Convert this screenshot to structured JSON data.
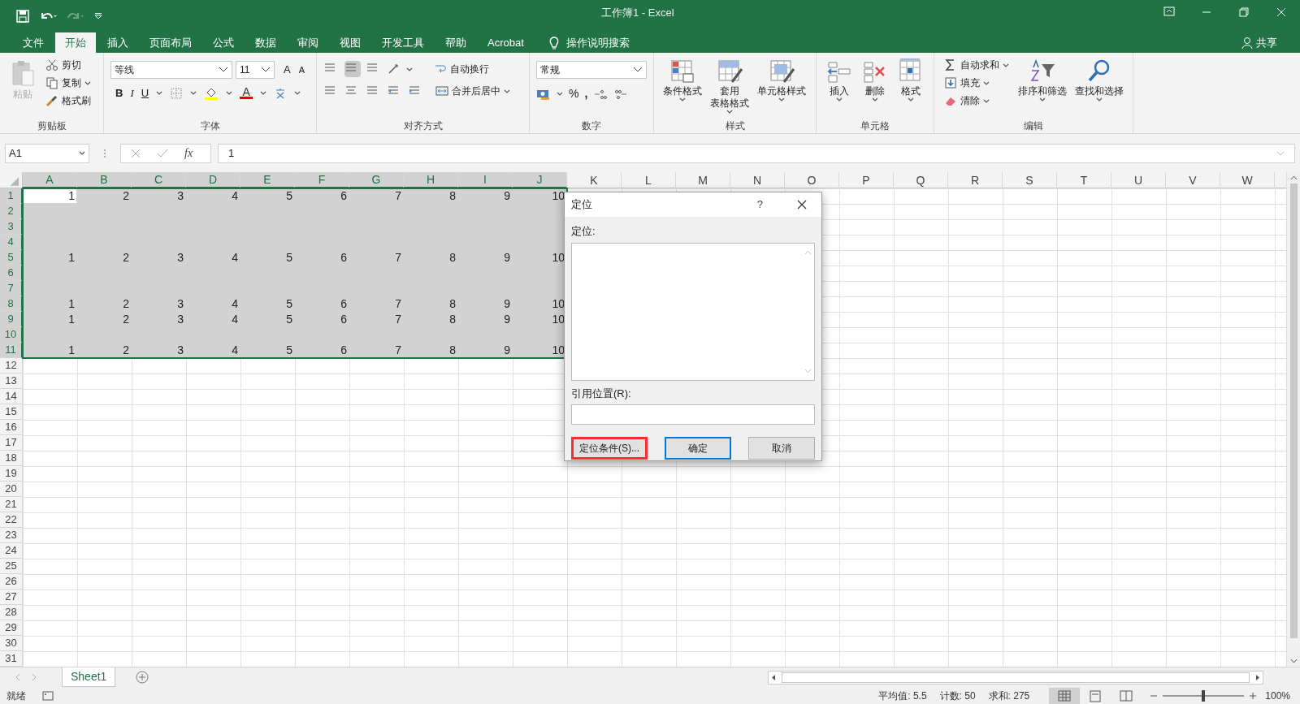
{
  "window": {
    "title": "工作簿1 - Excel"
  },
  "menu_tabs": [
    {
      "label": "文件",
      "selected": false
    },
    {
      "label": "开始",
      "selected": true
    },
    {
      "label": "插入",
      "selected": false
    },
    {
      "label": "页面布局",
      "selected": false
    },
    {
      "label": "公式",
      "selected": false
    },
    {
      "label": "数据",
      "selected": false
    },
    {
      "label": "审阅",
      "selected": false
    },
    {
      "label": "视图",
      "selected": false
    },
    {
      "label": "开发工具",
      "selected": false
    },
    {
      "label": "帮助",
      "selected": false
    },
    {
      "label": "Acrobat",
      "selected": false
    }
  ],
  "tell_me": "操作说明搜索",
  "share": "共享",
  "ribbon": {
    "clipboard": {
      "label": "剪贴板",
      "paste": "粘贴",
      "items": [
        "剪切",
        "复制",
        "格式刷"
      ]
    },
    "font": {
      "label": "字体",
      "font_name": "等线",
      "font_size": "11",
      "grow": "A",
      "shrink": "A",
      "bold": "B",
      "italic": "I",
      "underline": "U",
      "font_color": "A"
    },
    "alignment": {
      "label": "对齐方式",
      "wrap": "自动换行",
      "merge": "合并后居中"
    },
    "number": {
      "label": "数字",
      "format": "常规",
      "percent": "%",
      "comma": ","
    },
    "styles": {
      "label": "样式",
      "buttons": [
        [
          "条件格式"
        ],
        [
          "套用",
          "表格格式"
        ],
        [
          "单元格样式"
        ]
      ]
    },
    "cells": {
      "label": "单元格",
      "buttons": [
        "插入",
        "删除",
        "格式"
      ]
    },
    "editing": {
      "label": "编辑",
      "items": [
        "自动求和",
        "填充",
        "清除"
      ],
      "buttons": [
        "排序和筛选",
        "查找和选择"
      ]
    }
  },
  "formula_bar": {
    "name_box": "A1",
    "fx": "fx",
    "value": "1"
  },
  "sheet": {
    "columns": [
      {
        "label": "A",
        "selected": true
      },
      {
        "label": "B",
        "selected": true
      },
      {
        "label": "C",
        "selected": true
      },
      {
        "label": "D",
        "selected": true
      },
      {
        "label": "E",
        "selected": true
      },
      {
        "label": "F",
        "selected": true
      },
      {
        "label": "G",
        "selected": true
      },
      {
        "label": "H",
        "selected": true
      },
      {
        "label": "I",
        "selected": true
      },
      {
        "label": "J",
        "selected": true
      },
      {
        "label": "K",
        "selected": false
      },
      {
        "label": "L",
        "selected": false
      },
      {
        "label": "M",
        "selected": false
      },
      {
        "label": "N",
        "selected": false
      },
      {
        "label": "O",
        "selected": false
      },
      {
        "label": "P",
        "selected": false
      },
      {
        "label": "Q",
        "selected": false
      },
      {
        "label": "R",
        "selected": false
      },
      {
        "label": "S",
        "selected": false
      },
      {
        "label": "T",
        "selected": false
      },
      {
        "label": "U",
        "selected": false
      },
      {
        "label": "V",
        "selected": false
      },
      {
        "label": "W",
        "selected": false
      }
    ],
    "rows": [
      {
        "label": "1",
        "selected": true,
        "cells": [
          "1",
          "2",
          "3",
          "4",
          "5",
          "6",
          "7",
          "8",
          "9",
          "10"
        ]
      },
      {
        "label": "2",
        "selected": true
      },
      {
        "label": "3",
        "selected": true
      },
      {
        "label": "4",
        "selected": true
      },
      {
        "label": "5",
        "selected": true,
        "cells": [
          "1",
          "2",
          "3",
          "4",
          "5",
          "6",
          "7",
          "8",
          "9",
          "10"
        ]
      },
      {
        "label": "6",
        "selected": true
      },
      {
        "label": "7",
        "selected": true
      },
      {
        "label": "8",
        "selected": true,
        "cells": [
          "1",
          "2",
          "3",
          "4",
          "5",
          "6",
          "7",
          "8",
          "9",
          "10"
        ]
      },
      {
        "label": "9",
        "selected": true,
        "cells": [
          "1",
          "2",
          "3",
          "4",
          "5",
          "6",
          "7",
          "8",
          "9",
          "10"
        ]
      },
      {
        "label": "10",
        "selected": true
      },
      {
        "label": "11",
        "selected": true,
        "cells": [
          "1",
          "2",
          "3",
          "4",
          "5",
          "6",
          "7",
          "8",
          "9",
          "10"
        ]
      },
      {
        "label": "12",
        "selected": false
      },
      {
        "label": "13",
        "selected": false
      },
      {
        "label": "14",
        "selected": false
      },
      {
        "label": "15",
        "selected": false
      },
      {
        "label": "16",
        "selected": false
      },
      {
        "label": "17",
        "selected": false
      },
      {
        "label": "18",
        "selected": false
      },
      {
        "label": "19",
        "selected": false
      },
      {
        "label": "20",
        "selected": false
      },
      {
        "label": "21",
        "selected": false
      },
      {
        "label": "22",
        "selected": false
      },
      {
        "label": "23",
        "selected": false
      },
      {
        "label": "24",
        "selected": false
      },
      {
        "label": "25",
        "selected": false
      },
      {
        "label": "26",
        "selected": false
      },
      {
        "label": "27",
        "selected": false
      },
      {
        "label": "28",
        "selected": false
      },
      {
        "label": "29",
        "selected": false
      },
      {
        "label": "30",
        "selected": false
      },
      {
        "label": "31",
        "selected": false
      }
    ]
  },
  "dialog": {
    "title": "定位",
    "help": "?",
    "list_label": "定位:",
    "reference_label": "引用位置(R):",
    "buttons": [
      {
        "label": "定位条件(S)...",
        "highlighted": true,
        "default": false
      },
      {
        "label": "确定",
        "highlighted": false,
        "default": true
      },
      {
        "label": "取消",
        "highlighted": false,
        "default": false
      }
    ]
  },
  "sheet_tabs": [
    {
      "label": "Sheet1",
      "selected": true
    }
  ],
  "status_bar": {
    "ready": "就绪",
    "stats": [
      "平均值: 5.5",
      "计数: 50",
      "求和: 275"
    ],
    "zoom": "100%",
    "zoom_slider": {
      "level": 0.5
    }
  }
}
